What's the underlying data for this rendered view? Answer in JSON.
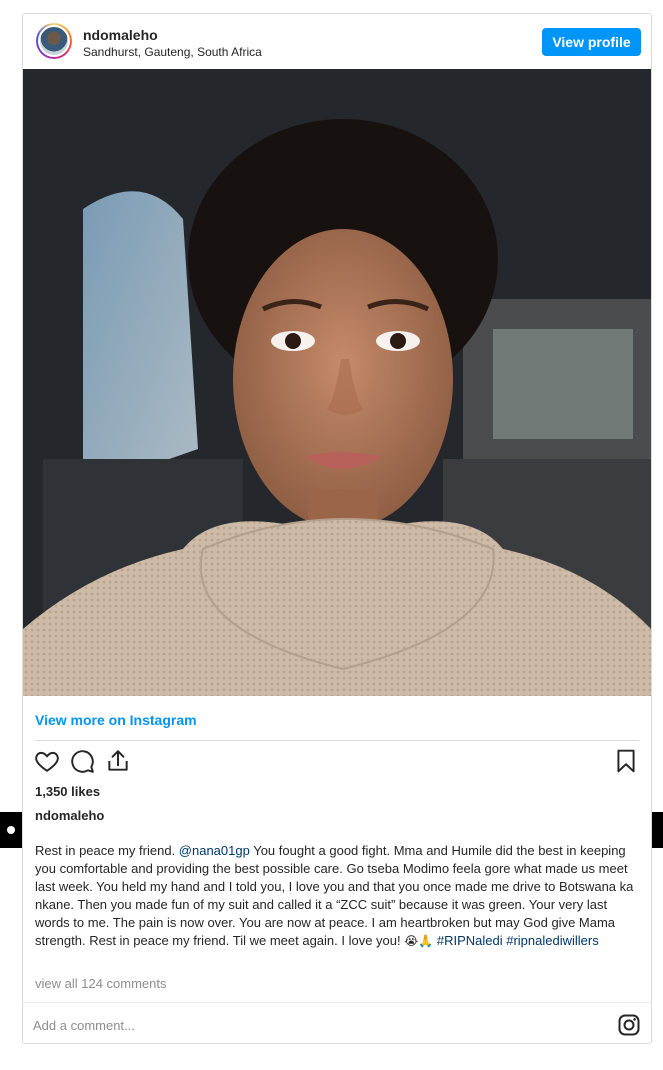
{
  "header": {
    "username": "ndomaleho",
    "location": "Sandhurst, Gauteng, South Africa",
    "view_profile_label": "View profile"
  },
  "post": {
    "image_icon": "portrait-photo",
    "view_more_label": "View more on Instagram",
    "likes_text": "1,350 likes",
    "author": "ndomaleho",
    "caption": {
      "intro": "Rest in peace my friend. ",
      "mention": "@nana01gp",
      "body": " You fought a good fight. Mma and Humile did the best in keeping you comfortable and providing the best possible care. Go tseba Modimo feela gore what made us meet last week. You held my hand and I told you, I love you and that you once made me drive to Botswana ka nkane. Then you made fun of my suit and called it a “ZCC suit” because it was green. Your very last words to me. The pain is now over. You are now at peace. I am heartbroken but may God give Mama strength. Rest in peace my friend. Til we meet again. I love you! ",
      "emojis": "😭🙏",
      "tag1": "#RIPNaledi",
      "tag2": "#ripnalediwillers"
    },
    "view_comments_label": "view all 124 comments",
    "add_comment_placeholder": "Add a comment..."
  },
  "icons": {
    "like": "heart-icon",
    "comment": "comment-icon",
    "share": "share-icon",
    "save": "bookmark-icon",
    "brand": "instagram-icon"
  },
  "colors": {
    "accent": "#0095f6",
    "link": "#00376b",
    "muted": "#8e8e8e",
    "border": "#dbdbdb"
  }
}
